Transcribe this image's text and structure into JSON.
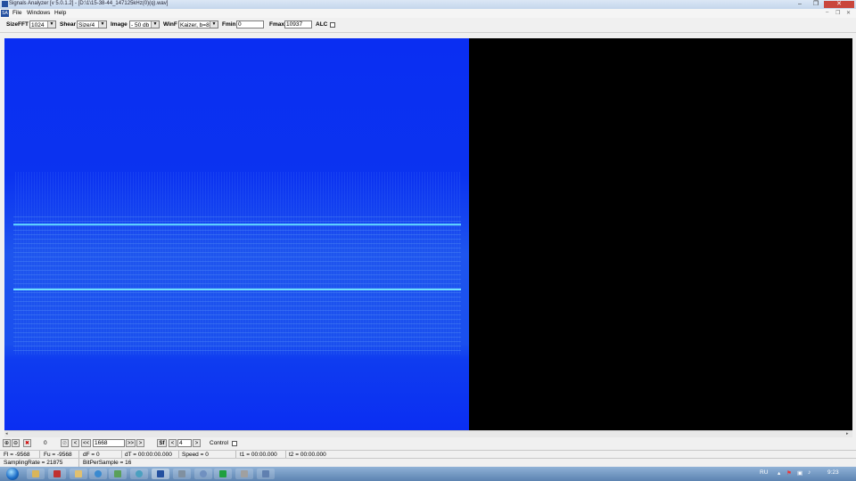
{
  "window": {
    "title": "Signals Analyzer [v 5.0.1.2] - [D:\\1\\15-38-44_147125kHz(0)(q).wav]",
    "controls": [
      "–",
      "❐",
      "✕"
    ]
  },
  "app_icon": "SA",
  "menu": [
    "File",
    "Windows",
    "Help"
  ],
  "toolbar": {
    "sizefft_label": "SizeFFT",
    "sizefft_value": "1024",
    "shear_label": "Shear",
    "shear_value": "Size/4",
    "image_label": "Image",
    "image_value": "- 50 db",
    "winf_label": "WinF",
    "winf_value": "Kaizer, b=8",
    "fmin_label": "Fmin",
    "fmin_value": "0",
    "fmax_label": "Fmax",
    "fmax_value": "10937",
    "alc_label": "ALC"
  },
  "controls": {
    "counter": "0",
    "prev_fast": "<<",
    "prev": "<",
    "position": "1668",
    "next_fast": ">>",
    "next": ">",
    "sf_label": "Sf",
    "step_prev": "<",
    "step_value": "4",
    "step_next": ">",
    "control_label": "Control"
  },
  "status1": {
    "fl": "Fl = -9568",
    "fu": "Fu = -9568",
    "df": "dF = 0",
    "dt": "dT = 00:00:00.000",
    "speed": "Speed = 0",
    "t1": "t1 = 00:00.000",
    "t2": "t2 = 00:00.000"
  },
  "status2": {
    "sampling": "SamplingRate = 21875",
    "bits": "BitPerSample = 16"
  },
  "taskbar": {
    "lang": "RU",
    "time": "9:23"
  },
  "colors": {
    "spectrogram_bg": "#0a2ef2",
    "signal_line": "#5fd6ff",
    "pane_black": "#000000"
  }
}
